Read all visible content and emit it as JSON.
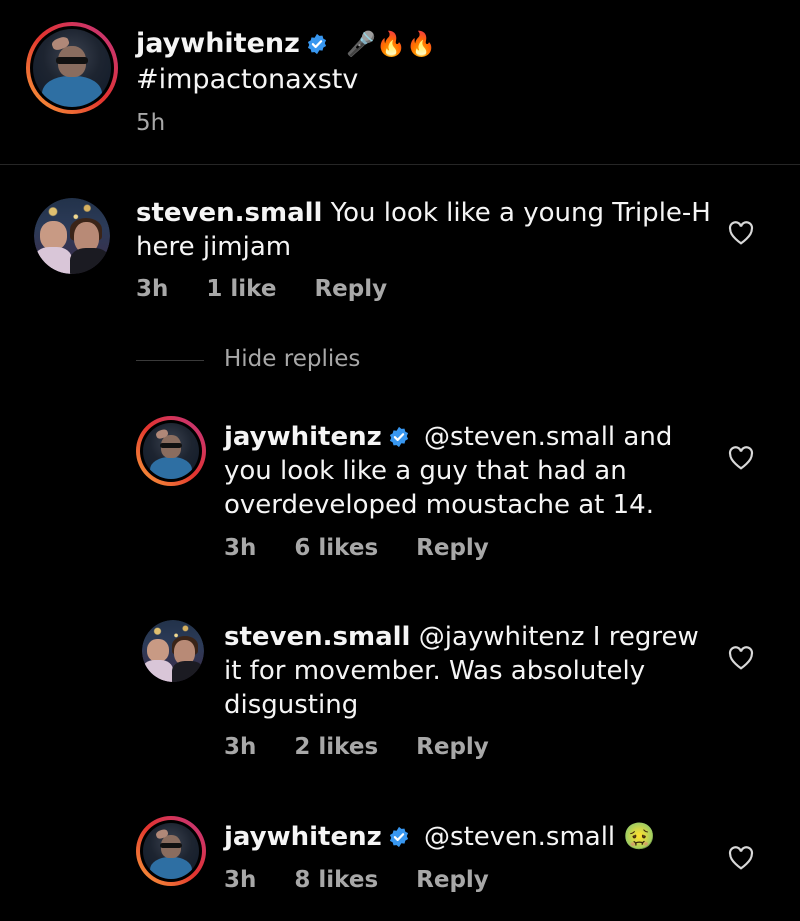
{
  "post": {
    "username": "jaywhitenz",
    "emojis": "🎤🔥🔥",
    "caption": "#impactonaxstv",
    "time": "5h"
  },
  "comments": [
    {
      "username": "steven.small",
      "text_line1": "You look like a young Triple-H",
      "text_line2": "here jimjam",
      "time": "3h",
      "likes": "1 like",
      "reply": "Reply"
    }
  ],
  "hide_replies": "Hide replies",
  "replies": [
    {
      "username": "jaywhitenz",
      "text_line1": "@steven.small and",
      "text_line2": "you look like a guy that had an",
      "text_line3": "overdeveloped moustache at 14.",
      "time": "3h",
      "likes": "6 likes",
      "reply": "Reply"
    },
    {
      "username": "steven.small",
      "text_line1": "@jaywhitenz I regrew",
      "text_line2": "it for movember. Was absolutely",
      "text_line3": "disgusting",
      "time": "3h",
      "likes": "2 likes",
      "reply": "Reply"
    },
    {
      "username": "jaywhitenz",
      "text_line1": "@steven.small",
      "emoji": "🤢",
      "time": "3h",
      "likes": "8 likes",
      "reply": "Reply"
    }
  ],
  "colors": {
    "background": "#000000",
    "text": "#f5f5f5",
    "meta": "#a8a8a8",
    "verified": "#3897f0"
  }
}
